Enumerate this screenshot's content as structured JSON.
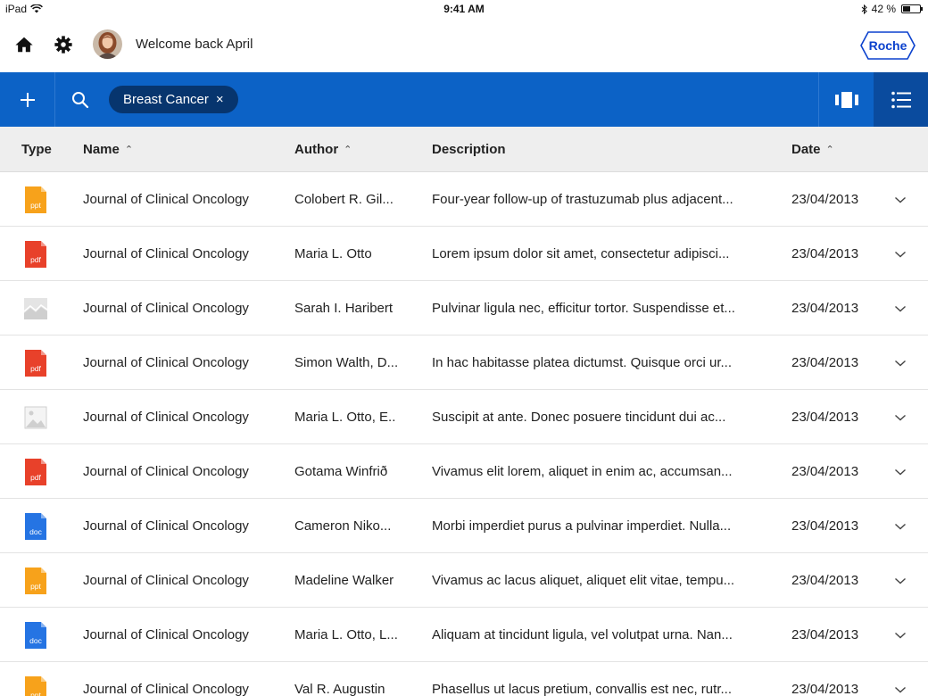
{
  "status_bar": {
    "device": "iPad",
    "time": "9:41 AM",
    "battery": "42 %",
    "battery_level": 0.42
  },
  "header": {
    "welcome": "Welcome back April",
    "logo_text": "Roche"
  },
  "toolbar": {
    "add_label": "+",
    "filter_chip": "Breast Cancer",
    "filter_chip_close": "×"
  },
  "columns": {
    "type": "Type",
    "name": "Name",
    "author": "Author",
    "description": "Description",
    "date": "Date"
  },
  "colors": {
    "toolbar_blue": "#0c62c6",
    "ppt": "#f7a21b",
    "pdf": "#e8412a",
    "doc": "#2574e3",
    "image": "#d4d4d4"
  },
  "rows": [
    {
      "type": "ppt",
      "name": "Journal of Clinical Oncology",
      "author": "Colobert R. Gil...",
      "description": "Four-year follow-up of trastuzumab plus adjacent...",
      "date": "23/04/2013"
    },
    {
      "type": "pdf",
      "name": "Journal of Clinical Oncology",
      "author": "Maria L. Otto",
      "description": "Lorem ipsum dolor sit amet, consectetur adipisci...",
      "date": "23/04/2013"
    },
    {
      "type": "chart",
      "name": "Journal of Clinical Oncology",
      "author": "Sarah I. Haribert",
      "description": "Pulvinar ligula nec, efficitur tortor. Suspendisse et...",
      "date": "23/04/2013"
    },
    {
      "type": "pdf",
      "name": "Journal of Clinical Oncology",
      "author": "Simon Walth, D...",
      "description": "In hac habitasse platea dictumst. Quisque orci ur...",
      "date": "23/04/2013"
    },
    {
      "type": "image",
      "name": "Journal of Clinical Oncology",
      "author": "Maria L. Otto, E..",
      "description": "Suscipit at ante. Donec posuere tincidunt dui ac...",
      "date": "23/04/2013"
    },
    {
      "type": "pdf",
      "name": "Journal of Clinical Oncology",
      "author": "Gotama Winfrið",
      "description": "Vivamus elit lorem, aliquet in enim ac, accumsan...",
      "date": "23/04/2013"
    },
    {
      "type": "doc",
      "name": "Journal of Clinical Oncology",
      "author": "Cameron Niko...",
      "description": "Morbi imperdiet purus a pulvinar imperdiet. Nulla...",
      "date": "23/04/2013"
    },
    {
      "type": "ppt",
      "name": "Journal of Clinical Oncology",
      "author": "Madeline Walker",
      "description": "Vivamus ac lacus aliquet, aliquet elit vitae, tempu...",
      "date": "23/04/2013"
    },
    {
      "type": "doc",
      "name": "Journal of Clinical Oncology",
      "author": "Maria L. Otto, L...",
      "description": "Aliquam at tincidunt ligula, vel volutpat urna. Nan...",
      "date": "23/04/2013"
    },
    {
      "type": "ppt",
      "name": "Journal of Clinical Oncology",
      "author": "Val R. Augustin",
      "description": "Phasellus ut lacus pretium, convallis est nec, rutr...",
      "date": "23/04/2013"
    }
  ]
}
